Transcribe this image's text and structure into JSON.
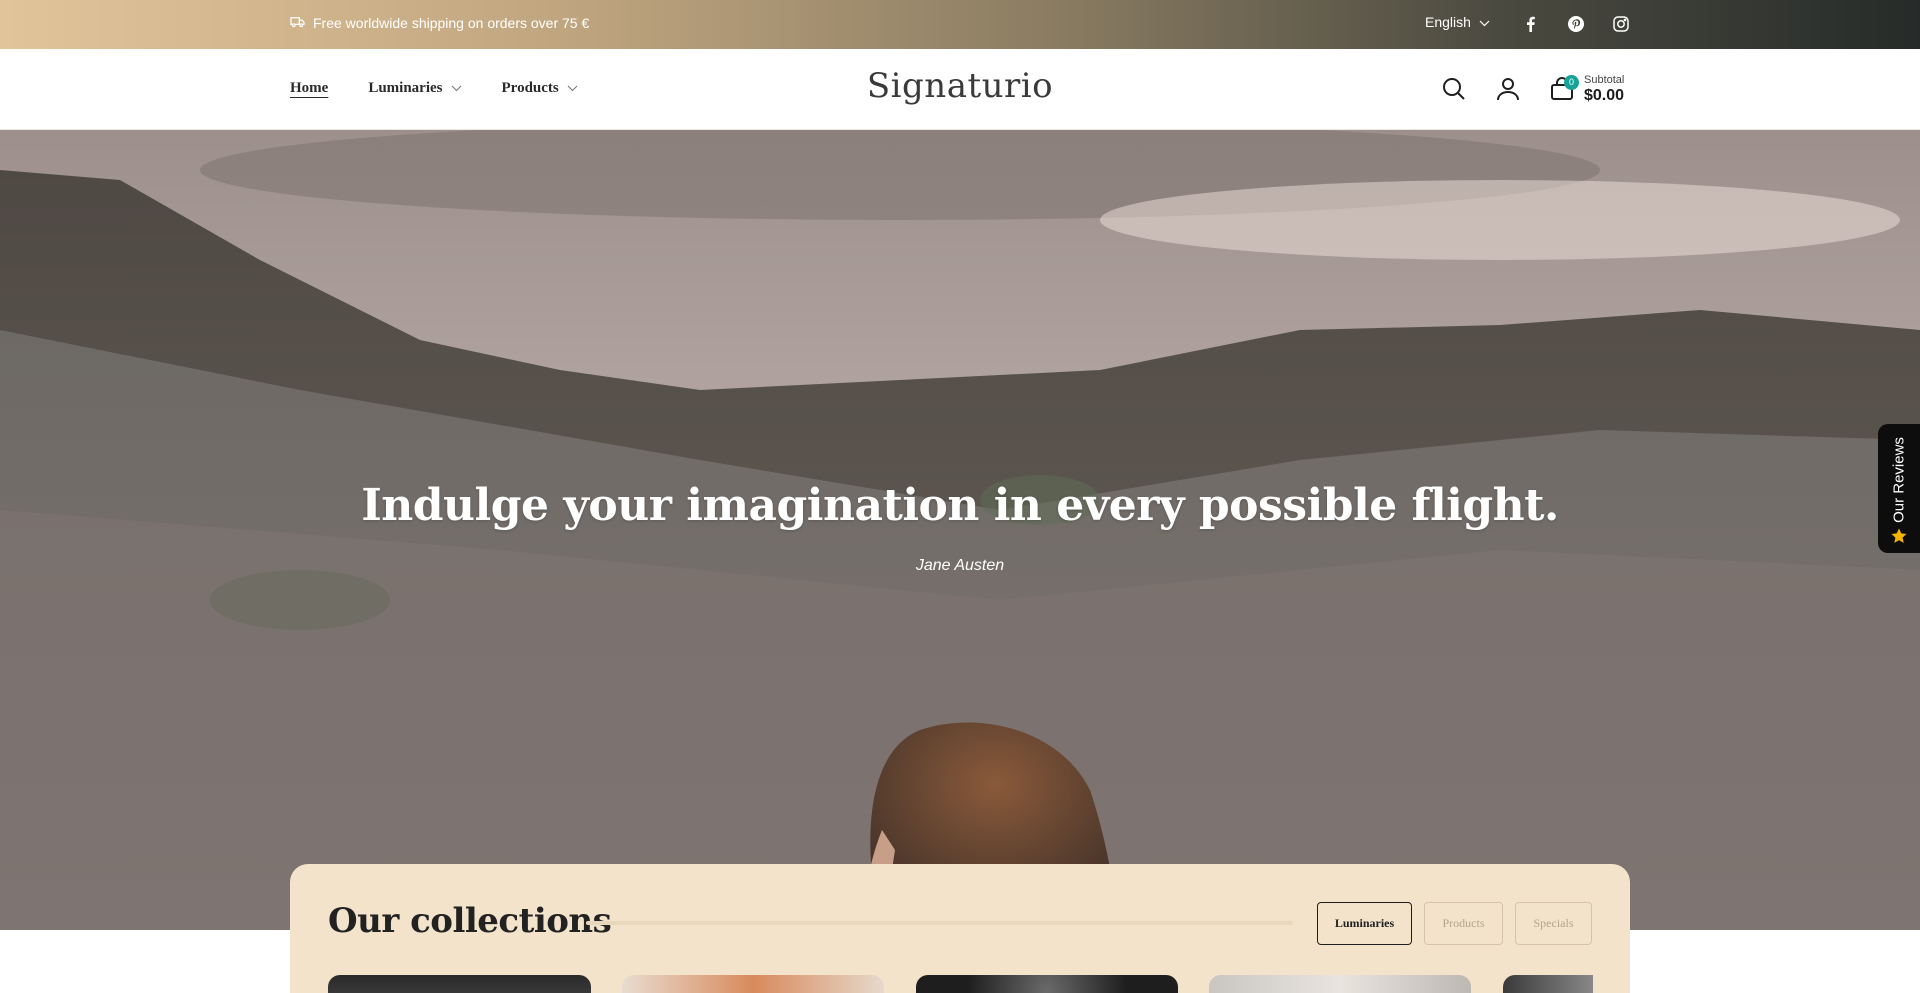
{
  "announcement": {
    "shipping_text": "Free worldwide shipping on orders over 75 €",
    "language": "English"
  },
  "header": {
    "logo": "Signaturio",
    "nav": [
      {
        "label": "Home",
        "has_dropdown": false,
        "active": true
      },
      {
        "label": "Luminaries",
        "has_dropdown": true,
        "active": false
      },
      {
        "label": "Products",
        "has_dropdown": true,
        "active": false
      }
    ],
    "cart": {
      "count": "0",
      "subtotal_label": "Subtotal",
      "subtotal_value": "$0.00"
    },
    "icons": [
      "search-icon",
      "account-icon",
      "cart-icon"
    ]
  },
  "hero": {
    "quote": "Indulge your imagination in every possible flight.",
    "author": "Jane Austen"
  },
  "reviews_tab": {
    "label": "Our Reviews"
  },
  "collections": {
    "heading": "Our collections",
    "tabs": [
      {
        "label": "Luminaries",
        "active": true
      },
      {
        "label": "Products",
        "active": false
      },
      {
        "label": "Specials",
        "active": false
      }
    ]
  },
  "colors": {
    "accent_teal": "#16a39a",
    "collections_bg": "#f3e3cb",
    "reviews_tab_bg": "#0d0d0d",
    "star": "#f4b400"
  }
}
